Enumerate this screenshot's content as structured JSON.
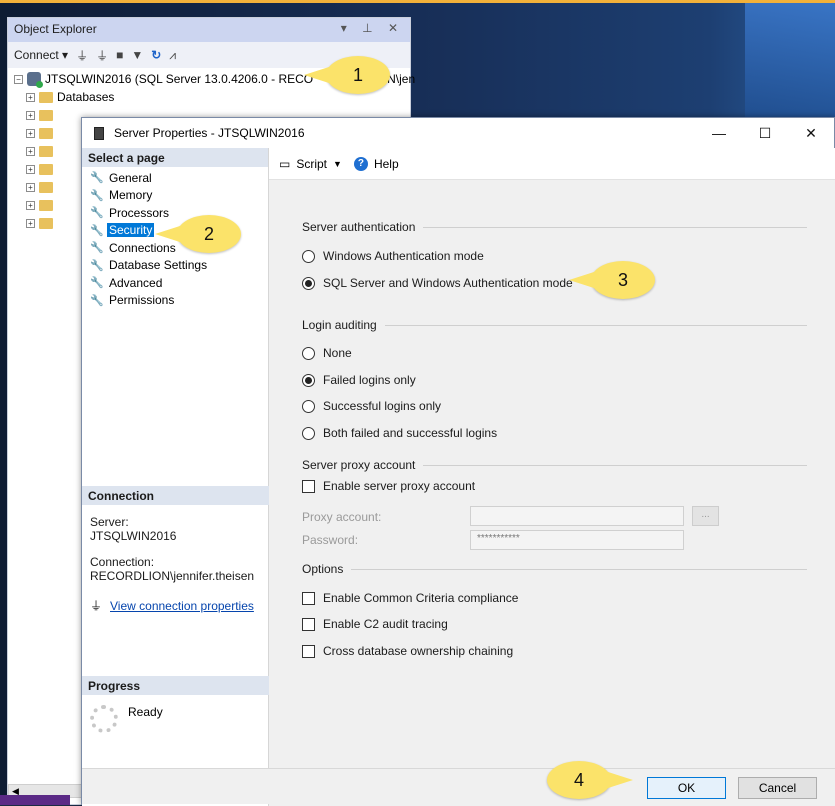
{
  "object_explorer": {
    "title": "Object Explorer",
    "title_controls": "▾ ⊥ ✕",
    "connect_label": "Connect ▾",
    "server_node": "JTSQLWIN2016 (SQL Server 13.0.4206.0 - RECO",
    "server_node_tail": "N\\jen",
    "databases_label": "Databases"
  },
  "dialog": {
    "title": "Server Properties - JTSQLWIN2016",
    "minimize": "—",
    "maximize": "☐",
    "close": "✕",
    "select_page_header": "Select a page",
    "pages": [
      "General",
      "Memory",
      "Processors",
      "Security",
      "Connections",
      "Database Settings",
      "Advanced",
      "Permissions"
    ],
    "selected_page": "Security",
    "connection": {
      "header": "Connection",
      "server_label": "Server:",
      "server_value": "JTSQLWIN2016",
      "connection_label": "Connection:",
      "connection_value": "RECORDLION\\jennifer.theisen",
      "link": "View connection properties"
    },
    "progress": {
      "header": "Progress",
      "status": "Ready"
    },
    "toolbar": {
      "script_label": "Script",
      "help_label": "Help"
    },
    "server_authentication": {
      "header": "Server authentication",
      "windows_mode": "Windows Authentication mode",
      "mixed_mode": "SQL Server and Windows Authentication mode",
      "selected": "mixed"
    },
    "login_auditing": {
      "header": "Login auditing",
      "none": "None",
      "failed": "Failed logins only",
      "successful": "Successful logins only",
      "both": "Both failed and successful logins",
      "selected": "failed"
    },
    "proxy": {
      "header": "Server proxy account",
      "enable_label": "Enable server proxy account",
      "proxy_account_label": "Proxy account:",
      "password_label": "Password:",
      "password_value": "***********",
      "browse_label": "..."
    },
    "options": {
      "header": "Options",
      "common_criteria": "Enable Common Criteria compliance",
      "c2_audit": "Enable C2 audit tracing",
      "cross_db": "Cross database ownership chaining"
    },
    "ok_label": "OK",
    "cancel_label": "Cancel"
  },
  "callouts": [
    "1",
    "2",
    "3",
    "4"
  ],
  "colors": {
    "selection": "#0078d7",
    "callout": "#fbe36a",
    "section_header": "#dde4ef"
  }
}
